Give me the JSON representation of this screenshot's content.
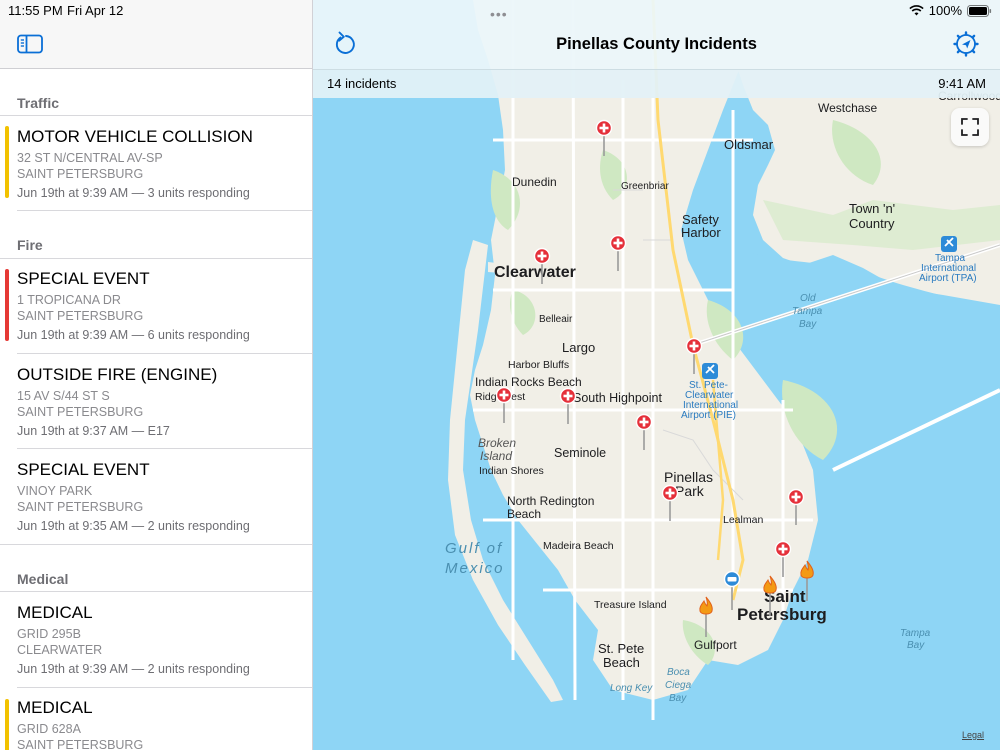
{
  "status": {
    "time": "11:55 PM",
    "date": "Fri Apr 12",
    "battery": "100%"
  },
  "nav": {
    "title": "Pinellas County Incidents",
    "grabber": "•••"
  },
  "info_bar": {
    "count": "14 incidents",
    "updated": "9:41 AM"
  },
  "icons": {
    "sidebar_toggle": "sidebar-toggle-icon",
    "refresh": "refresh-icon",
    "settings": "gear-location-icon",
    "fullscreen": "fullscreen-icon",
    "wifi": "wifi-icon",
    "battery": "battery-icon",
    "medical": "medical-cross-icon",
    "fire": "fire-icon",
    "police": "police-car-icon"
  },
  "colors": {
    "traffic": "#f2c200",
    "fire": "#e53935",
    "medical": "#f2c200",
    "pin": "#e5303a",
    "water": "#8ed5f5",
    "tint": "#0a6fd6"
  },
  "sections": {
    "traffic": "Traffic",
    "fire": "Fire",
    "medical": "Medical"
  },
  "incidents": [
    {
      "title": "MOTOR VEHICLE COLLISION",
      "address": "32 ST N/CENTRAL AV-SP",
      "city": "SAINT PETERSBURG",
      "meta": "Jun 19th at 9:39 AM — 3 units responding"
    },
    {
      "title": "SPECIAL EVENT",
      "address": "1 TROPICANA DR",
      "city": "SAINT PETERSBURG",
      "meta": "Jun 19th at 9:39 AM — 6 units responding"
    },
    {
      "title": "OUTSIDE FIRE (ENGINE)",
      "address": "15 AV S/44 ST S",
      "city": "SAINT PETERSBURG",
      "meta": "Jun 19th at 9:37 AM — E17"
    },
    {
      "title": "SPECIAL EVENT",
      "address": "VINOY PARK",
      "city": "SAINT PETERSBURG",
      "meta": "Jun 19th at 9:35 AM — 2 units responding"
    },
    {
      "title": "MEDICAL",
      "address": "GRID 295B",
      "city": "CLEARWATER",
      "meta": "Jun 19th at 9:39 AM — 2 units responding"
    },
    {
      "title": "MEDICAL",
      "address": "GRID 628A",
      "city": "SAINT PETERSBURG",
      "meta": ""
    }
  ],
  "map_labels": {
    "westchase": "Westchase",
    "oldsmar": "Oldsmar",
    "dunedin": "Dunedin",
    "greenbriar": "Greenbriar",
    "safety_harbor_1": "Safety",
    "safety_harbor_2": "Harbor",
    "town_country_1": "Town 'n'",
    "town_country_2": "Country",
    "clearwater": "Clearwater",
    "tpa_1": "Tampa",
    "tpa_2": "International",
    "tpa_3": "Airport (TPA)",
    "old_tampa_1": "Old",
    "old_tampa_2": "Tampa",
    "old_tampa_3": "Bay",
    "belleair": "Belleair",
    "largo": "Largo",
    "harbor_bluffs": "Harbor Bluffs",
    "indian_rocks": "Indian Rocks Beach",
    "pie_1": "St. Pete-",
    "pie_2": "Clearwater",
    "pie_3": "International",
    "pie_4": "Airport (PIE)",
    "ridgecrest": "Ridgecrest",
    "south_highpoint": "South Highpoint",
    "broken_1": "Broken",
    "broken_2": "Island",
    "seminole": "Seminole",
    "indian_shores": "Indian Shores",
    "pinellas_1": "Pinellas",
    "pinellas_2": "Park",
    "north_redington_1": "North Redington",
    "north_redington_2": "Beach",
    "lealman": "Lealman",
    "gulf_1": "Gulf of",
    "gulf_2": "Mexico",
    "madeira": "Madeira Beach",
    "treasure": "Treasure Island",
    "saint": "Saint",
    "petersburg": "Petersburg",
    "tampa_bay_1": "Tampa",
    "tampa_bay_2": "Bay",
    "st_pete_beach_1": "St. Pete",
    "st_pete_beach_2": "Beach",
    "gulfport": "Gulfport",
    "long_key": "Long Key",
    "boca_1": "Boca",
    "boca_2": "Ciega",
    "boca_3": "Bay",
    "top_cut": "Carrollwood"
  },
  "legal": "Legal"
}
